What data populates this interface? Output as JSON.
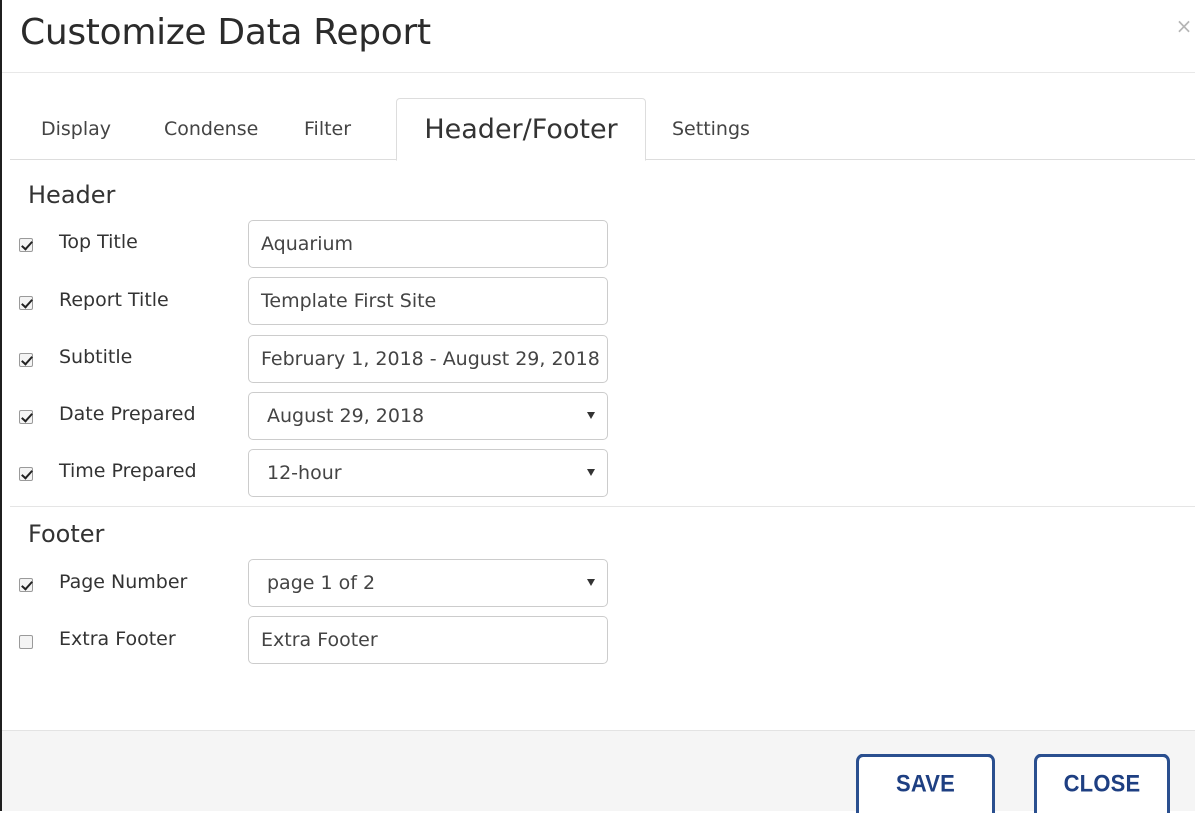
{
  "dialog": {
    "title": "Customize Data Report",
    "close_glyph": "×"
  },
  "tabs": [
    {
      "label": "Display",
      "active": false
    },
    {
      "label": "Condense",
      "active": false
    },
    {
      "label": "Filter",
      "active": false
    },
    {
      "label": "Header/Footer",
      "active": true
    },
    {
      "label": "Settings",
      "active": false
    }
  ],
  "header": {
    "title": "Header",
    "rows": [
      {
        "label": "Top Title",
        "checked": true,
        "type": "text",
        "value": "Aquarium"
      },
      {
        "label": "Report Title",
        "checked": true,
        "type": "text",
        "value": "Template First Site"
      },
      {
        "label": "Subtitle",
        "checked": true,
        "type": "text",
        "value": "February 1, 2018 - August 29, 2018"
      },
      {
        "label": "Date Prepared",
        "checked": true,
        "type": "select",
        "value": "August 29, 2018"
      },
      {
        "label": "Time Prepared",
        "checked": true,
        "type": "select",
        "value": "12-hour"
      }
    ]
  },
  "footer": {
    "title": "Footer",
    "rows": [
      {
        "label": "Page Number",
        "checked": true,
        "type": "select",
        "value": "page 1 of 2"
      },
      {
        "label": "Extra Footer",
        "checked": false,
        "type": "text",
        "value": "Extra Footer"
      }
    ]
  },
  "buttons": {
    "save": "SAVE",
    "close": "CLOSE"
  },
  "colors": {
    "button_border": "#2a4f8f",
    "button_text": "#1e3f82",
    "footer_bg": "#f5f5f5"
  }
}
